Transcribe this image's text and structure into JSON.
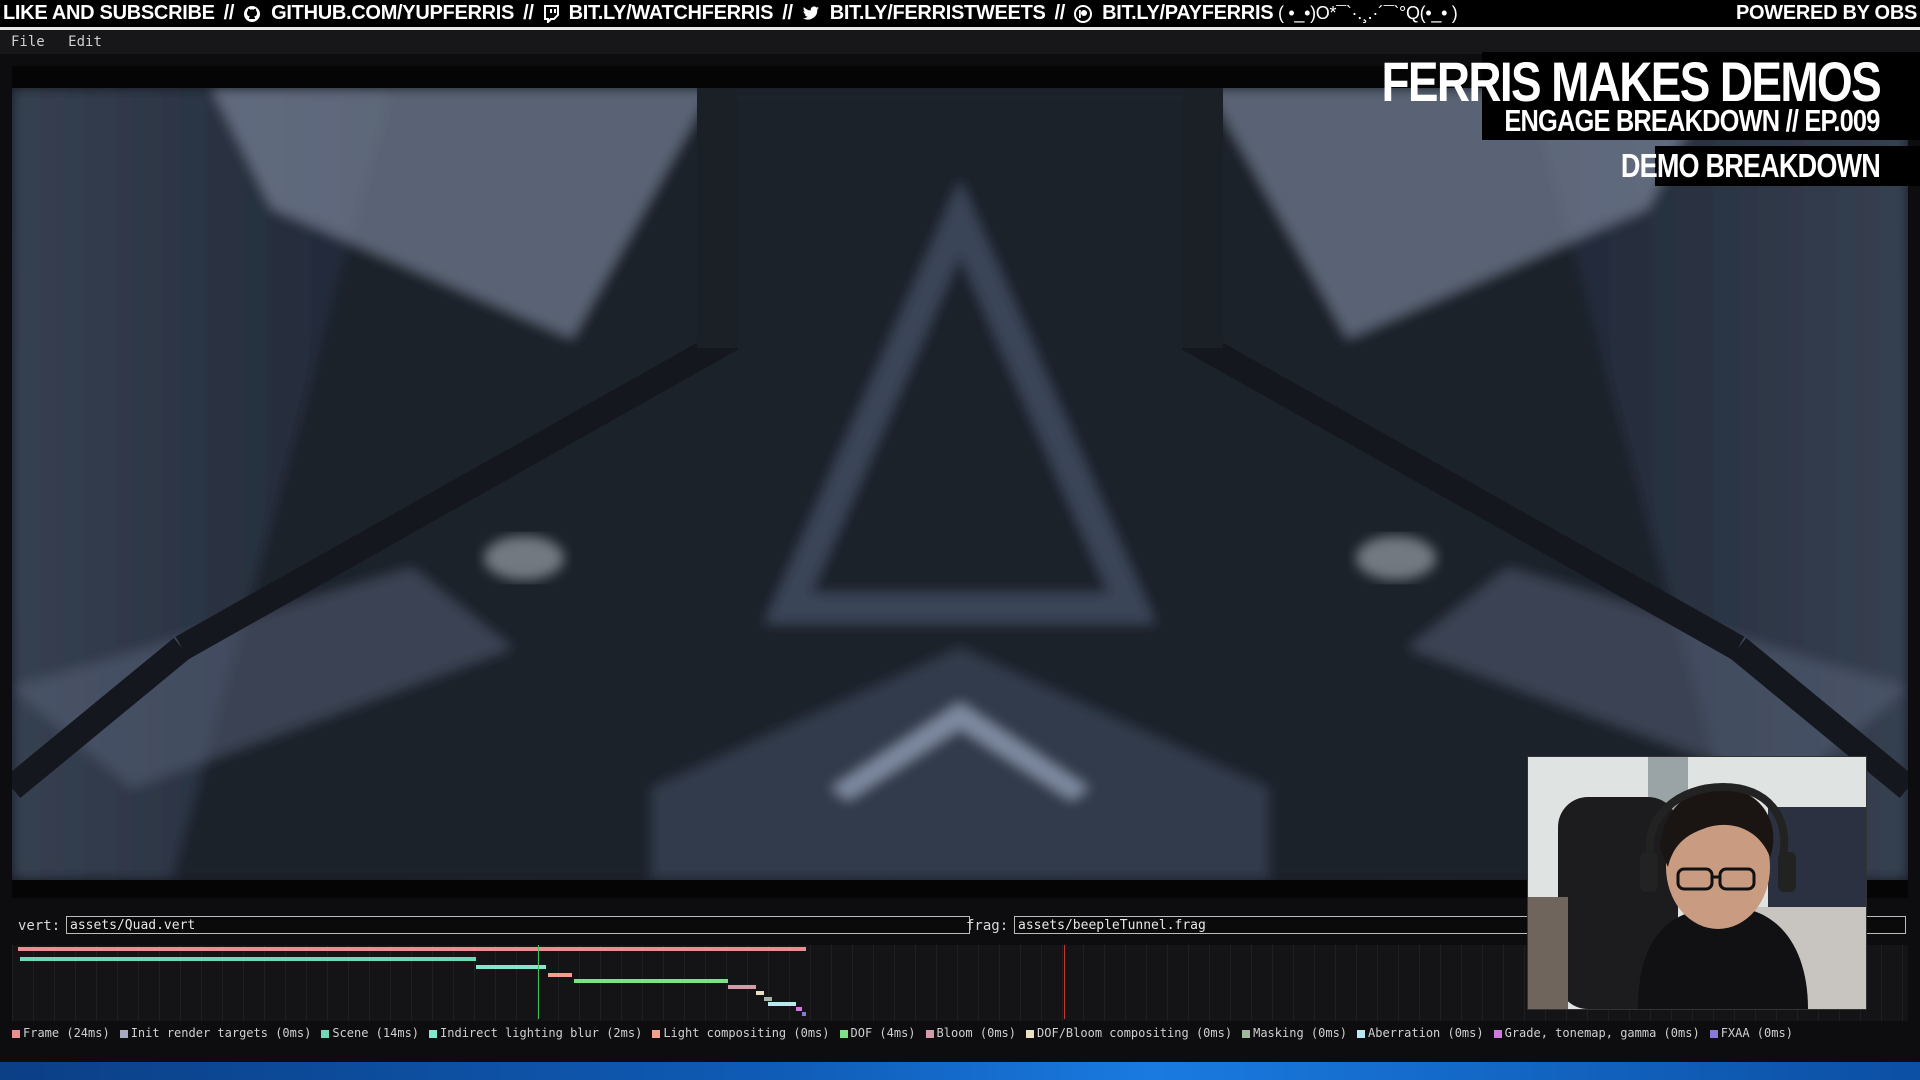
{
  "banner": {
    "like": "LIKE AND SUBSCRIBE",
    "sep": "//",
    "github": "GITHUB.COM/YUPFERRIS",
    "twitch": "BIT.LY/WATCHFERRIS",
    "twitter": "BIT.LY/FERRISTWEETS",
    "patreon": "BIT.LY/PAYFERRIS",
    "emoticon": "( •_•)O*¯`·.¸.·´¯`°Q(•_• )",
    "powered": "POWERED BY OBS"
  },
  "menu": {
    "file": "File",
    "edit": "Edit"
  },
  "overlay": {
    "title": "FERRIS MAKES DEMOS",
    "subtitle_left": "ENGAGE BREAKDOWN",
    "subtitle_sep": "//",
    "subtitle_right": "EP.009",
    "section": "DEMO BREAKDOWN"
  },
  "shader": {
    "vert_label": "vert:",
    "vert_value": "assets/Quad.vert",
    "frag_label": "frag:",
    "frag_value": "assets/beepleTunnel.frag"
  },
  "legend": [
    {
      "label": "Frame (24ms)",
      "color": "#e88f8f"
    },
    {
      "label": "Init render targets (0ms)",
      "color": "#a8a8c0"
    },
    {
      "label": "Scene (14ms)",
      "color": "#6fd8b4"
    },
    {
      "label": "Indirect lighting blur (2ms)",
      "color": "#7fe8cf"
    },
    {
      "label": "Light compositing (0ms)",
      "color": "#f2a08a"
    },
    {
      "label": "DOF (4ms)",
      "color": "#7fe08a"
    },
    {
      "label": "Bloom (0ms)",
      "color": "#d49aa8"
    },
    {
      "label": "DOF/Bloom compositing (0ms)",
      "color": "#e8e0c0"
    },
    {
      "label": "Masking (0ms)",
      "color": "#9fb8a0"
    },
    {
      "label": "Aberration (0ms)",
      "color": "#b8e8f0"
    },
    {
      "label": "Grade, tonemap, gamma (0ms)",
      "color": "#d07ae0"
    },
    {
      "label": "FXAA (0ms)",
      "color": "#8a78d8"
    }
  ]
}
